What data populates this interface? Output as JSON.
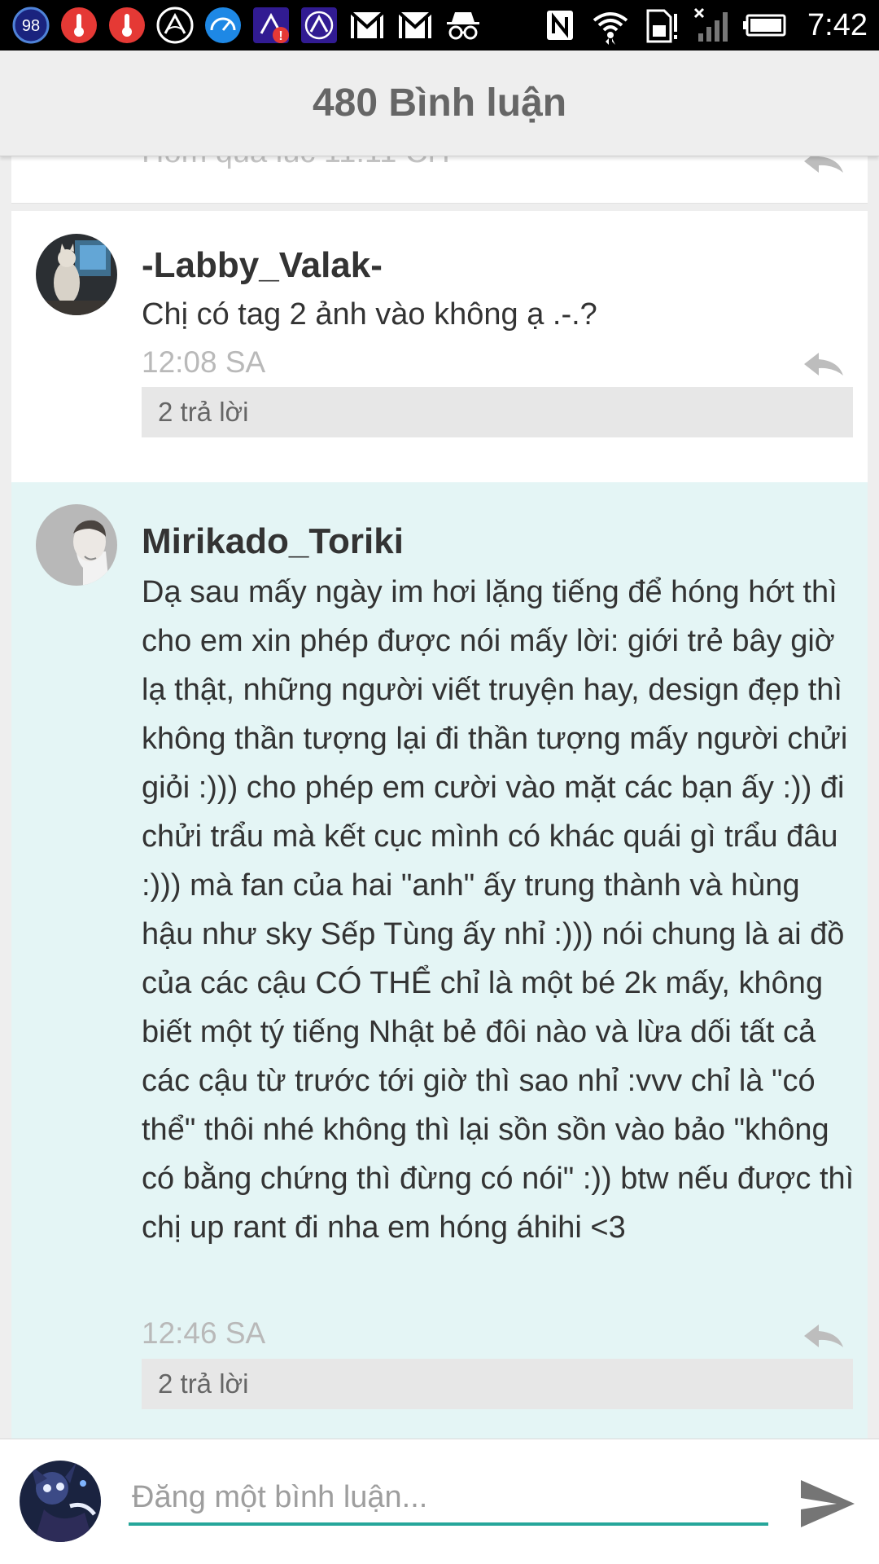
{
  "status_bar": {
    "badge_count": "98",
    "time": "7:42",
    "icons": [
      "badge-98-icon",
      "thermometer-icon",
      "thermometer-icon",
      "app-arc-icon",
      "speedometer-icon",
      "app-alert-icon",
      "app-arc-icon",
      "gmail-icon",
      "gmail-icon",
      "incognito-icon",
      "nfc-icon",
      "wifi-icon",
      "sim-alert-icon",
      "signal-icon",
      "battery-icon"
    ]
  },
  "header": {
    "title": "480 Bình luận"
  },
  "comments": [
    {
      "username": "-Labby_Valak-",
      "text": "Chị có tag 2 ảnh vào không ạ .-.?",
      "time": "12:08 SA",
      "replies": "2 trả lời"
    },
    {
      "username": "Mirikado_Toriki",
      "text": "Dạ sau mấy ngày im hơi lặng tiếng để hóng hớt thì cho em xin phép được nói mấy lời: giới trẻ bây giờ lạ thật, những người viết truyện hay, design đẹp thì không thần tượng lại đi thần tượng mấy người chửi giỏi :))) cho phép em cười vào mặt các bạn ấy :)) đi chửi trẩu mà kết cục mình có khác quái gì trẩu đâu :))) mà fan của hai \"anh\" ấy trung thành và hùng hậu như sky Sếp Tùng ấy nhỉ :))) nói chung là ai đồ của các cậu CÓ THỂ chỉ là một bé 2k mấy, không biết một tý tiếng Nhật bẻ đôi nào và lừa dối tất cả các cậu từ trước tới giờ thì sao nhỉ :vvv chỉ là \"có thể\" thôi nhé không thì lại sồn sồn vào bảo \"không có bằng chứng thì đừng có nói\" :)) btw nếu được thì chị up rant đi nha em hóng áhihi <3",
      "time": "12:46 SA",
      "replies": "2 trả lời"
    }
  ],
  "composer": {
    "placeholder": "Đăng một bình luận..."
  },
  "colors": {
    "accent": "#26a69a",
    "highlight_bg": "#e4f5f5"
  }
}
